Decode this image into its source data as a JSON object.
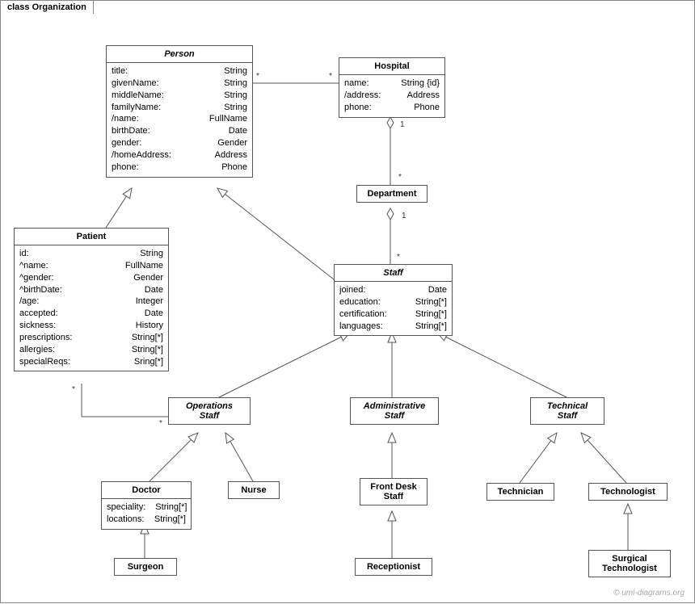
{
  "frame": {
    "title": "class Organization"
  },
  "watermark": "© uml-diagrams.org",
  "classes": {
    "person": {
      "name": "Person",
      "attrs": [
        {
          "n": "title:",
          "t": "String"
        },
        {
          "n": "givenName:",
          "t": "String"
        },
        {
          "n": "middleName:",
          "t": "String"
        },
        {
          "n": "familyName:",
          "t": "String"
        },
        {
          "n": "/name:",
          "t": "FullName"
        },
        {
          "n": "birthDate:",
          "t": "Date"
        },
        {
          "n": "gender:",
          "t": "Gender"
        },
        {
          "n": "/homeAddress:",
          "t": "Address"
        },
        {
          "n": "phone:",
          "t": "Phone"
        }
      ]
    },
    "hospital": {
      "name": "Hospital",
      "attrs": [
        {
          "n": "name:",
          "t": "String {id}"
        },
        {
          "n": "/address:",
          "t": "Address"
        },
        {
          "n": "phone:",
          "t": "Phone"
        }
      ]
    },
    "department": {
      "name": "Department"
    },
    "patient": {
      "name": "Patient",
      "attrs": [
        {
          "n": "id:",
          "t": "String"
        },
        {
          "n": "^name:",
          "t": "FullName"
        },
        {
          "n": "^gender:",
          "t": "Gender"
        },
        {
          "n": "^birthDate:",
          "t": "Date"
        },
        {
          "n": "/age:",
          "t": "Integer"
        },
        {
          "n": "accepted:",
          "t": "Date"
        },
        {
          "n": "sickness:",
          "t": "History"
        },
        {
          "n": "prescriptions:",
          "t": "String[*]"
        },
        {
          "n": "allergies:",
          "t": "String[*]"
        },
        {
          "n": "specialReqs:",
          "t": "Sring[*]"
        }
      ]
    },
    "staff": {
      "name": "Staff",
      "attrs": [
        {
          "n": "joined:",
          "t": "Date"
        },
        {
          "n": "education:",
          "t": "String[*]"
        },
        {
          "n": "certification:",
          "t": "String[*]"
        },
        {
          "n": "languages:",
          "t": "String[*]"
        }
      ]
    },
    "opsstaff": {
      "name": "Operations",
      "name2": "Staff"
    },
    "adminstaff": {
      "name": "Administrative",
      "name2": "Staff"
    },
    "techstaff": {
      "name": "Technical",
      "name2": "Staff"
    },
    "doctor": {
      "name": "Doctor",
      "attrs": [
        {
          "n": "speciality:",
          "t": "String[*]"
        },
        {
          "n": "locations:",
          "t": "String[*]"
        }
      ]
    },
    "nurse": {
      "name": "Nurse"
    },
    "frontdesk": {
      "name": "Front Desk",
      "name2": "Staff"
    },
    "technician": {
      "name": "Technician"
    },
    "technologist": {
      "name": "Technologist"
    },
    "surgeon": {
      "name": "Surgeon"
    },
    "receptionist": {
      "name": "Receptionist"
    },
    "surgtech": {
      "name": "Surgical",
      "name2": "Technologist"
    }
  },
  "mults": {
    "person_hospital_l": "*",
    "person_hospital_r": "*",
    "hosp_dept_top": "1",
    "hosp_dept_bot": "*",
    "dept_staff_top": "1",
    "dept_staff_bot": "*",
    "patient_ops_l": "*",
    "patient_ops_r": "*"
  }
}
